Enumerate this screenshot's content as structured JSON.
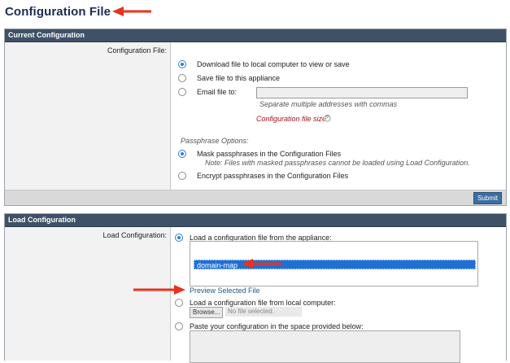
{
  "page": {
    "title": "Configuration File"
  },
  "current_config": {
    "header": "Current Configuration",
    "field_label": "Configuration File:",
    "options": [
      {
        "label": "Download file to local computer to view or save",
        "selected": true
      },
      {
        "label": "Save file to this appliance",
        "selected": false
      },
      {
        "label": "Email file to:",
        "selected": false
      }
    ],
    "email_hint": "Separate multiple addresses with commas",
    "file_size_label": "Configuration file size:",
    "passphrase_title": "Passphrase Options:",
    "passphrase_options": [
      {
        "label": "Mask passphrases in the Configuration Files",
        "selected": true,
        "note": "Note: Files with masked passphrases cannot be loaded using Load Configuration."
      },
      {
        "label": "Encrypt passphrases in the Configuration Files",
        "selected": false
      }
    ],
    "submit_label": "Submit"
  },
  "load_config": {
    "header": "Load Configuration",
    "field_label": "Load Configuration:",
    "options": [
      {
        "label": "Load a configuration file from the appliance:",
        "selected": true
      },
      {
        "label": "Load a configuration file from local computer:",
        "selected": false
      },
      {
        "label": "Paste your configuration in the space provided below:",
        "selected": false
      }
    ],
    "file_list": [
      "domain-map"
    ],
    "preview_link": "Preview Selected File",
    "browse_label": "Browse...",
    "no_file_label": "No file selected."
  },
  "colors": {
    "header_bg": "#3f5166",
    "accent_blue": "#1f6fd6",
    "annotation_arrow": "#e8321e"
  }
}
